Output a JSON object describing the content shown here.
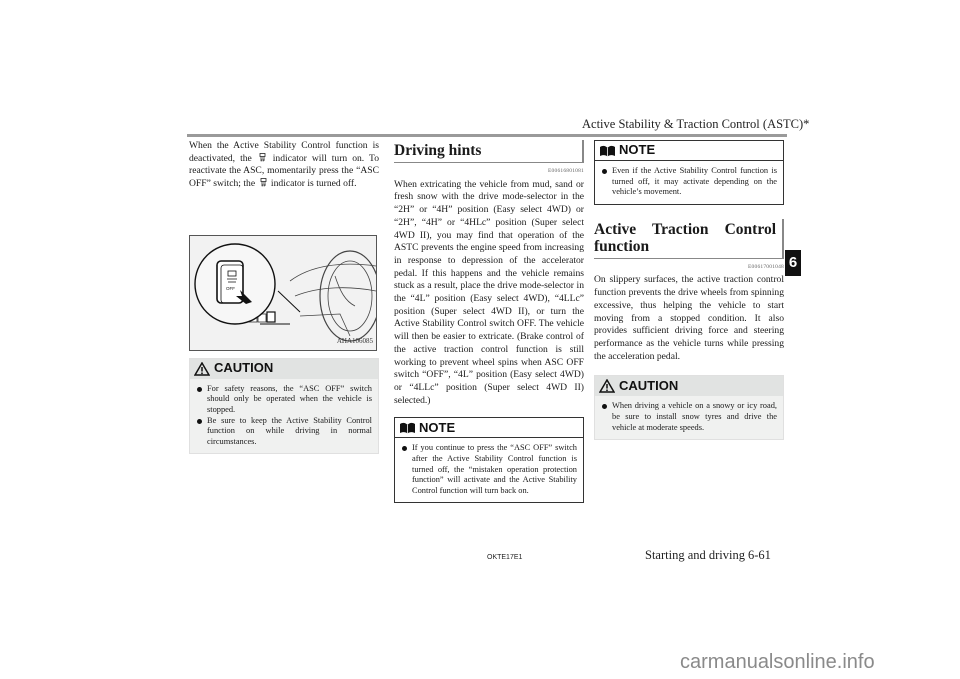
{
  "header": {
    "title": "Active Stability & Traction Control (ASTC)*"
  },
  "column1": {
    "intro_parts": [
      "When the Active Stability Control function is deactivated, the ",
      " indicator will turn on. To reactivate the ASC, momentarily press the “ASC OFF” switch; the ",
      " indicator is turned off."
    ],
    "indicator_icon": "asc-off-indicator-icon",
    "figure_code": "AHA106085",
    "caution": {
      "label": "CAUTION",
      "items": [
        "For safety reasons, the “ASC OFF” switch should only be operated when the vehicle is stopped.",
        "Be sure to keep the Active Stability Control function on while driving in normal circumstances."
      ]
    }
  },
  "column2": {
    "section_title": "Driving hints",
    "ref_code": "E00616801081",
    "body": "When extricating the vehicle from mud, sand or fresh snow with the drive mode-selector in the “2H” or “4H” position (Easy select 4WD) or “2H”, “4H” or “4HLc” position (Super select 4WD II), you may find that operation of the ASTC prevents the engine speed from increasing in response to depression of the accelerator pedal. If this happens and the vehicle remains stuck as a result, place the drive mode-selector in the “4L” position (Easy select 4WD), “4LLc” position (Super select 4WD II), or turn the Active Stability Control switch OFF. The vehicle will then be easier to extricate. (Brake control of the active traction control function is still working to prevent wheel spins when ASC OFF switch “OFF”, “4L” position (Easy select 4WD) or “4LLc” position (Super select 4WD II) selected.)",
    "note": {
      "label": "NOTE",
      "items": [
        "If you continue to press the “ASC OFF” switch after the Active Stability Control function is turned off, the “mistaken operation protection function” will activate and the Active Stability Control function will turn back on."
      ]
    }
  },
  "column3": {
    "note": {
      "label": "NOTE",
      "items": [
        "Even if the Active Stability Control function is turned off, it may activate depending on the vehicle’s movement."
      ]
    },
    "section_title": "Active Traction Control function",
    "ref_code": "E00617001048",
    "body": "On slippery surfaces, the active traction control function prevents the drive wheels from spinning excessive, thus helping the vehicle to start moving from a stopped condition. It also provides sufficient driving force and steering performance as the vehicle turns while pressing the acceleration pedal.",
    "caution": {
      "label": "CAUTION",
      "items": [
        "When driving a vehicle on a snowy or icy road, be sure to install snow tyres and drive the vehicle at moderate speeds."
      ]
    }
  },
  "chapter_tab": "6",
  "footer": {
    "doc_code": "OKTE17E1",
    "section": "Starting and driving",
    "page": "6-61"
  },
  "watermark": "carmanualsonline.info"
}
